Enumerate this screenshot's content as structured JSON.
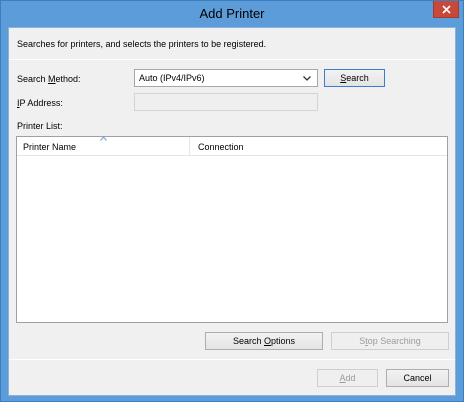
{
  "window": {
    "title": "Add Printer"
  },
  "description": "Searches for printers, and selects the printers to be registered.",
  "search": {
    "method_label_pre": "Search ",
    "method_label_hot": "M",
    "method_label_post": "ethod:",
    "method_value": "Auto (IPv4/IPv6)",
    "button_hot": "S",
    "button_rest": "earch"
  },
  "ip": {
    "label_hot": "I",
    "label_rest": "P Address:",
    "value": ""
  },
  "printer_list": {
    "label": "Printer List:",
    "columns": [
      "Printer Name",
      "Connection"
    ],
    "rows": []
  },
  "options_button": {
    "pre": "Search ",
    "hot": "O",
    "post": "ptions"
  },
  "stop_button": {
    "pre": "S",
    "hot": "t",
    "post": "op Searching"
  },
  "add_button": {
    "hot": "A",
    "rest": "dd"
  },
  "cancel_button": {
    "label": "Cancel"
  },
  "colors": {
    "title_bar": "#5c9cd9",
    "close_button": "#c7493b",
    "client_bg": "#f0f0f0"
  }
}
